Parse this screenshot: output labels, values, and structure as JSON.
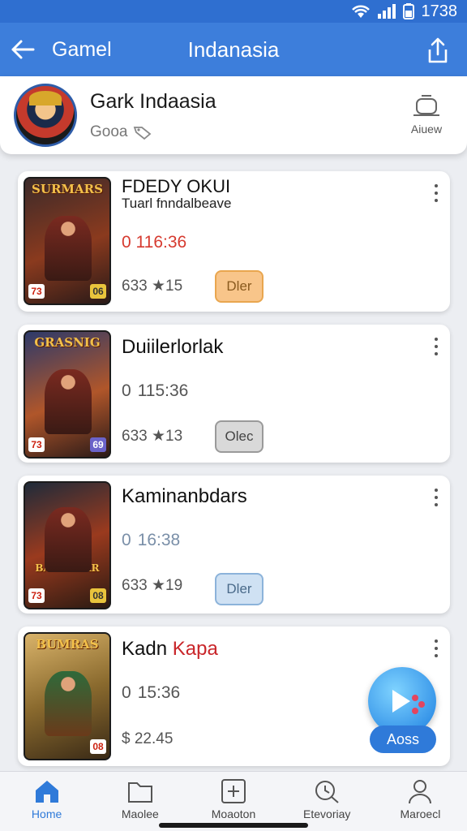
{
  "status_bar": {
    "time": "1738"
  },
  "app_bar": {
    "back_label": "Gamel",
    "title": "Indanasia"
  },
  "profile": {
    "name": "Gark Indaasia",
    "subtitle": "Gooa",
    "action_label": "Aiuew"
  },
  "games": [
    {
      "thumb_title": "SURMARS",
      "thumb_badge_left": "73",
      "thumb_badge_right": "06",
      "title": "FDEDY OKUI",
      "subtitle": "Tuarl fnndalbeave",
      "time": "0 116:36",
      "rating": "633 ★15",
      "button": "Dler"
    },
    {
      "thumb_title": "GRASNIG",
      "thumb_badge_left": "73",
      "thumb_badge_right": "69",
      "title": "Duiilerlorlak",
      "subtitle": "",
      "time": "115:36",
      "rating": "633 ★13",
      "button": "Olec"
    },
    {
      "thumb_title": "BAYE BEAR",
      "thumb_badge_left": "73",
      "thumb_badge_right": "08",
      "title": "Kaminanbdars",
      "subtitle": "",
      "time": "16:38",
      "rating": "633 ★19",
      "button": "Dler"
    },
    {
      "thumb_title": "BUMRAS",
      "thumb_badge_left": "",
      "thumb_badge_right": "08",
      "title": "Kadn",
      "title_accent": "Kapa",
      "subtitle": "",
      "time": "15:36",
      "rating": "$ 22.45",
      "button": ""
    }
  ],
  "fab": {
    "label": "Aoss"
  },
  "bottom_nav": [
    {
      "label": "Home",
      "icon": "home-icon"
    },
    {
      "label": "Maolee",
      "icon": "folder-icon"
    },
    {
      "label": "Moaoton",
      "icon": "plus-box-icon"
    },
    {
      "label": "Etevoriay",
      "icon": "search-clock-icon"
    },
    {
      "label": "Maroecl",
      "icon": "person-icon"
    }
  ],
  "colors": {
    "primary": "#3d7edb",
    "accent_red": "#d63a2f",
    "btn_orange": "#f8c58a",
    "btn_grey": "#d9d9d9",
    "btn_blue": "#cfe1f3"
  }
}
